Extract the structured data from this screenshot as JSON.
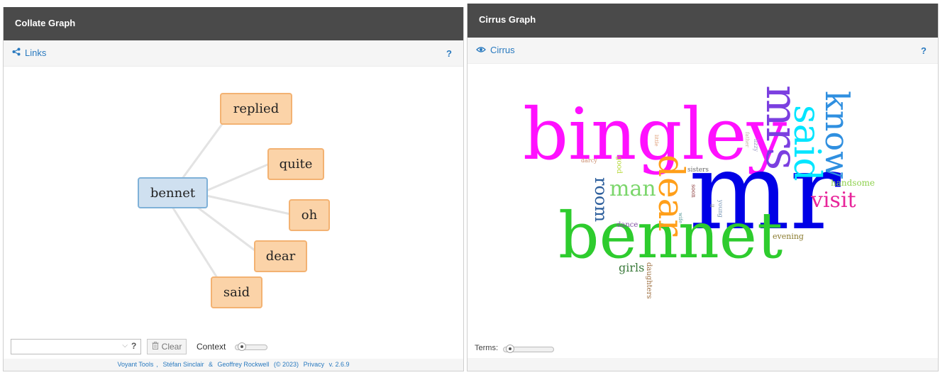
{
  "collate": {
    "title": "Collate Graph",
    "tab_label": "Links",
    "help": "?",
    "root": "bennet",
    "links": [
      "replied",
      "quite",
      "oh",
      "dear",
      "said"
    ],
    "footer": {
      "combo_value": "",
      "combo_help": "?",
      "clear_label": "Clear",
      "context_label": "Context",
      "context_slider": 0.1
    },
    "credits": {
      "voyant": "Voyant Tools",
      "sep1": ",",
      "sinclair": "Stéfan Sinclair",
      "amp": "&",
      "rockwell": "Geoffrey Rockwell",
      "year": "(© 2023)",
      "privacy": "Privacy",
      "version": "v. 2.6.9"
    }
  },
  "cirrus": {
    "title": "Cirrus Graph",
    "tab_label": "Cirrus",
    "help": "?",
    "terms_label": "Terms:",
    "terms_slider": 0.05,
    "words": [
      {
        "text": "bingley",
        "color": "#ff10ff"
      },
      {
        "text": "mr",
        "color": "#0000e6"
      },
      {
        "text": "bennet",
        "color": "#2ecc2e"
      },
      {
        "text": "mrs",
        "color": "#7b3fe0"
      },
      {
        "text": "said",
        "color": "#00e5ff"
      },
      {
        "text": "know",
        "color": "#2f8fe0"
      },
      {
        "text": "dear",
        "color": "#ff9f1a"
      },
      {
        "text": "man",
        "color": "#7bd66b"
      },
      {
        "text": "room",
        "color": "#2b5d9b"
      },
      {
        "text": "visit",
        "color": "#e8259a"
      },
      {
        "text": "handsome",
        "color": "#8fd14f"
      },
      {
        "text": "girls",
        "color": "#3b7a3b"
      },
      {
        "text": "daughters",
        "color": "#9a6b3b"
      },
      {
        "text": "dance",
        "color": "#7f4fa0"
      },
      {
        "text": "evening",
        "color": "#8a7b2e"
      },
      {
        "text": "sisters",
        "color": "#6b6b6b"
      },
      {
        "text": "good",
        "color": "#b1d62f"
      },
      {
        "text": "darcy",
        "color": "#c98a6a"
      },
      {
        "text": "soon",
        "color": "#8b3a3a"
      },
      {
        "text": "young",
        "color": "#6e8fb0"
      },
      {
        "text": "lizzy",
        "color": "#9a9ac0"
      },
      {
        "text": "father",
        "color": "#c0b0a0"
      },
      {
        "text": "little",
        "color": "#e0a07a"
      },
      {
        "text": "wife",
        "color": "#5a9a9a"
      },
      {
        "text": "ll",
        "color": "#888888"
      }
    ]
  }
}
